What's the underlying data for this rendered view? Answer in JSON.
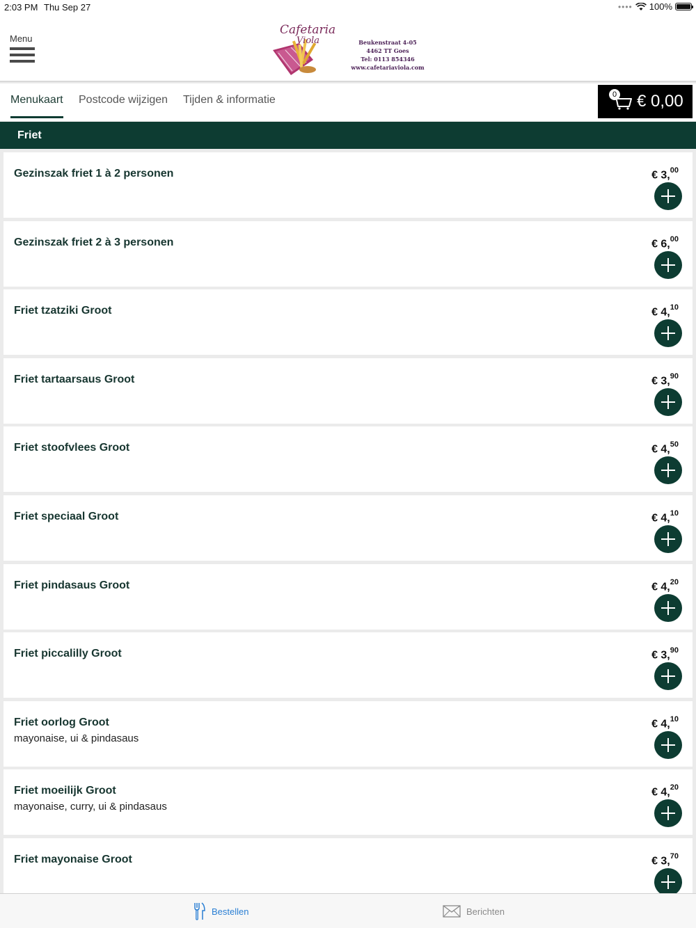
{
  "status_bar": {
    "time": "2:03 PM",
    "date": "Thu Sep 27",
    "battery": "100%"
  },
  "header": {
    "menu_label": "Menu",
    "logo": {
      "line1": "Cafetaria",
      "line2": "Viola",
      "address1": "Beukenstraat 4-05",
      "address2": "4462 TT Goes",
      "phone": "Tel: 0113 854346",
      "website": "www.cafetariaviola.com"
    }
  },
  "tabs": [
    {
      "label": "Menukaart",
      "active": true
    },
    {
      "label": "Postcode wijzigen",
      "active": false
    },
    {
      "label": "Tijden & informatie",
      "active": false
    }
  ],
  "cart": {
    "count": "0",
    "total": "€ 0,00"
  },
  "section": {
    "title": "Friet"
  },
  "products": [
    {
      "name": "Gezinszak friet 1 à 2 personen",
      "desc": "",
      "price_main": "€ 3,",
      "price_cents": "00"
    },
    {
      "name": "Gezinszak friet 2 à 3 personen",
      "desc": "",
      "price_main": "€ 6,",
      "price_cents": "00"
    },
    {
      "name": "Friet tzatziki Groot",
      "desc": "",
      "price_main": "€ 4,",
      "price_cents": "10"
    },
    {
      "name": "Friet tartaarsaus Groot",
      "desc": "",
      "price_main": "€ 3,",
      "price_cents": "90"
    },
    {
      "name": "Friet stoofvlees Groot",
      "desc": "",
      "price_main": "€ 4,",
      "price_cents": "50"
    },
    {
      "name": "Friet speciaal Groot",
      "desc": "",
      "price_main": "€ 4,",
      "price_cents": "10"
    },
    {
      "name": "Friet pindasaus Groot",
      "desc": "",
      "price_main": "€ 4,",
      "price_cents": "20"
    },
    {
      "name": "Friet piccalilly Groot",
      "desc": "",
      "price_main": "€ 3,",
      "price_cents": "90"
    },
    {
      "name": "Friet oorlog Groot",
      "desc": "mayonaise, ui & pindasaus",
      "price_main": "€ 4,",
      "price_cents": "10"
    },
    {
      "name": "Friet moeilijk Groot",
      "desc": "mayonaise, curry, ui & pindasaus",
      "price_main": "€ 4,",
      "price_cents": "20"
    },
    {
      "name": "Friet mayonaise Groot",
      "desc": "",
      "price_main": "€ 3,",
      "price_cents": "70"
    }
  ],
  "bottom_tabs": [
    {
      "label": "Bestellen",
      "icon": "fork-knife-icon",
      "active": true
    },
    {
      "label": "Berichten",
      "icon": "envelope-icon",
      "active": false
    }
  ],
  "colors": {
    "accent": "#0d3c32",
    "active_tab_blue": "#2a7fd4",
    "cart_bg": "#000000"
  }
}
